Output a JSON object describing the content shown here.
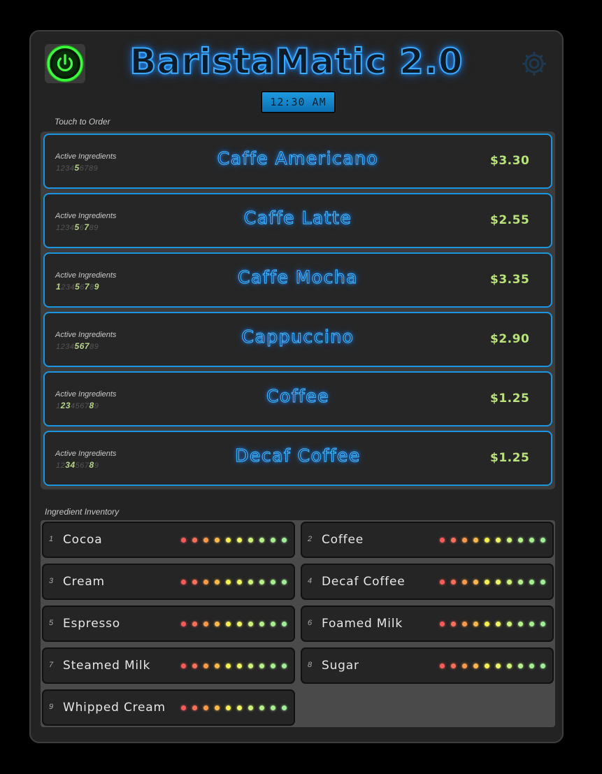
{
  "app": {
    "title": "BaristaMatic 2.0",
    "clock": "12:30 AM",
    "accent_color": "#1a96e0",
    "power_icon": "power-icon",
    "settings_icon": "gear-icon"
  },
  "menu": {
    "label": "Touch to Order",
    "active_label": "Active Ingredients",
    "items": [
      {
        "name": "Caffe Americano",
        "price": "$3.30",
        "active": [
          5
        ]
      },
      {
        "name": "Caffe Latte",
        "price": "$2.55",
        "active": [
          5,
          7
        ]
      },
      {
        "name": "Caffe Mocha",
        "price": "$3.35",
        "active": [
          1,
          5,
          7,
          9
        ]
      },
      {
        "name": "Cappuccino",
        "price": "$2.90",
        "active": [
          5,
          6,
          7
        ]
      },
      {
        "name": "Coffee",
        "price": "$1.25",
        "active": [
          2,
          3,
          8
        ]
      },
      {
        "name": "Decaf Coffee",
        "price": "$1.25",
        "active": [
          3,
          4,
          8
        ]
      }
    ]
  },
  "inventory": {
    "label": "Ingredient Inventory",
    "led_colors": [
      "#ff5a5a",
      "#ff6f5a",
      "#ff9a4a",
      "#ffb84a",
      "#f6ef50",
      "#eef566",
      "#cdf37a",
      "#b6f28a",
      "#a6f090",
      "#a0ee98"
    ],
    "items": [
      {
        "num": "1",
        "name": "Cocoa",
        "level": 10
      },
      {
        "num": "2",
        "name": "Coffee",
        "level": 10
      },
      {
        "num": "3",
        "name": "Cream",
        "level": 10
      },
      {
        "num": "4",
        "name": "Decaf Coffee",
        "level": 10
      },
      {
        "num": "5",
        "name": "Espresso",
        "level": 10
      },
      {
        "num": "6",
        "name": "Foamed Milk",
        "level": 10
      },
      {
        "num": "7",
        "name": "Steamed Milk",
        "level": 10
      },
      {
        "num": "8",
        "name": "Sugar",
        "level": 10
      },
      {
        "num": "9",
        "name": "Whipped Cream",
        "level": 10
      }
    ]
  }
}
